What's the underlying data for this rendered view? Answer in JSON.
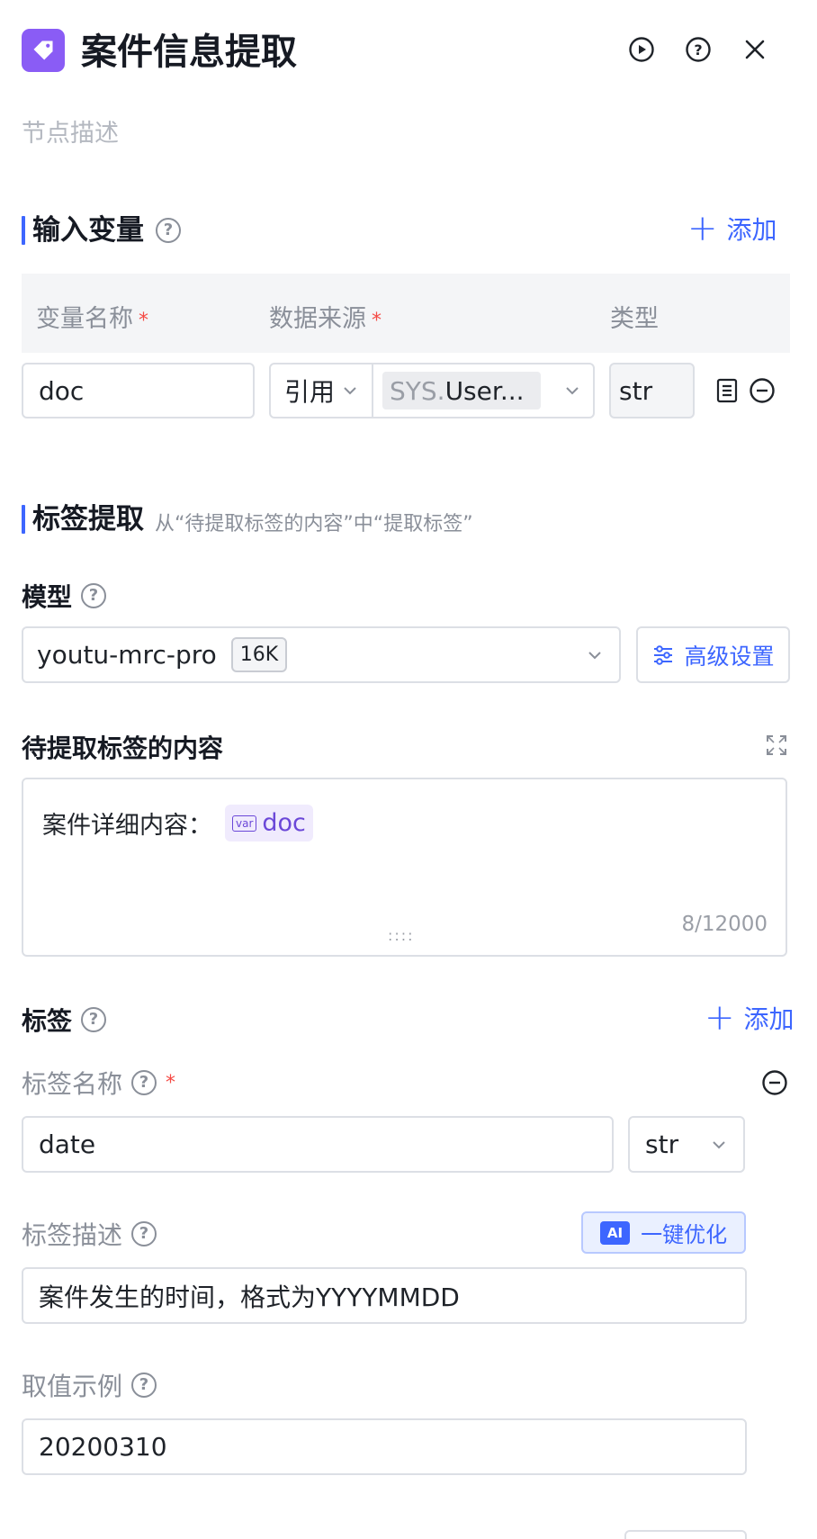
{
  "header": {
    "title": "案件信息提取",
    "description_placeholder": "节点描述"
  },
  "input_vars": {
    "title": "输入变量",
    "add_label": "添加",
    "columns": [
      "变量名称",
      "数据来源",
      "类型"
    ],
    "row": {
      "name": "doc",
      "source_mode": "引用",
      "source_prefix": "SYS.",
      "source_value": "User...",
      "type": "str"
    }
  },
  "extract": {
    "title": "标签提取",
    "subtitle": "从“待提取标签的内容”中“提取标签”",
    "model_label": "模型",
    "model_name": "youtu-mrc-pro",
    "model_context": "16K",
    "advanced_label": "高级设置",
    "content_label": "待提取标签的内容",
    "content_text": "案件详细内容：",
    "content_var_badge": "var",
    "content_var": "doc",
    "content_counter": "8/12000"
  },
  "tags": {
    "title": "标签",
    "add_label": "添加",
    "name_label": "标签名称",
    "name_value": "date",
    "type_value": "str",
    "desc_label": "标签描述",
    "ai_badge": "AI",
    "ai_optimize_label": "一键优化",
    "desc_value": "案件发生的时间，格式为YYYYMMDD",
    "example_label": "取值示例",
    "example_value": "20200310"
  },
  "colors": {
    "accent": "#3d66ff",
    "node_icon": "#8a5cf5",
    "required": "#f54a45",
    "var_chip_bg": "#f0ebfd",
    "var_chip_text": "#6b48d8"
  },
  "icons": {
    "node": "tag-icon",
    "run": "play-circle-icon",
    "help": "question-circle-icon",
    "close": "close-icon",
    "list": "list-icon",
    "remove": "minus-circle-icon",
    "settings": "sliders-icon",
    "expand": "expand-icon"
  }
}
